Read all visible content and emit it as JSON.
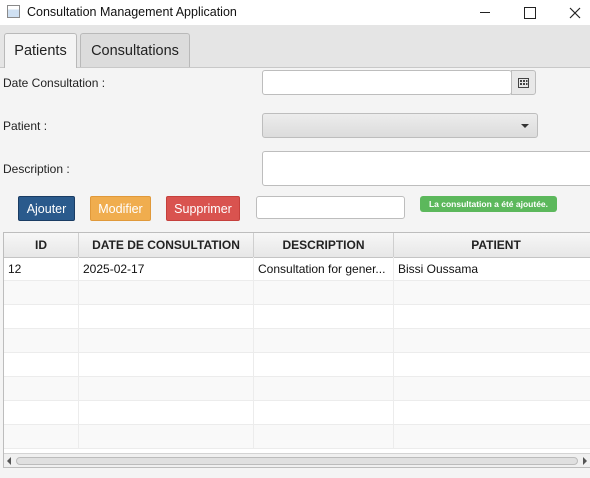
{
  "window": {
    "title": "Consultation Management Application"
  },
  "tabs": [
    {
      "label": "Patients",
      "active": true
    },
    {
      "label": "Consultations",
      "active": false
    }
  ],
  "form": {
    "date_label": "Date Consultation :",
    "date_value": "",
    "patient_label": "Patient :",
    "patient_value": "",
    "description_label": "Description :",
    "description_value": ""
  },
  "actions": {
    "add_label": "Ajouter",
    "edit_label": "Modifier",
    "delete_label": "Supprimer",
    "search_value": "",
    "status_message": "La consultation a été ajoutée.",
    "colors": {
      "add": "#2a5a8c",
      "edit": "#f0ad4e",
      "delete": "#d9534f",
      "status": "#5cb85c"
    }
  },
  "table": {
    "headers": [
      "ID",
      "DATE DE CONSULTATION",
      "DESCRIPTION",
      "PATIENT"
    ],
    "rows": [
      [
        "12",
        "2025-02-17",
        "Consultation for gener...",
        "Bissi Oussama"
      ]
    ]
  },
  "icons": {
    "calendar": "calendar-icon",
    "dropdown": "chevron-down-icon"
  }
}
